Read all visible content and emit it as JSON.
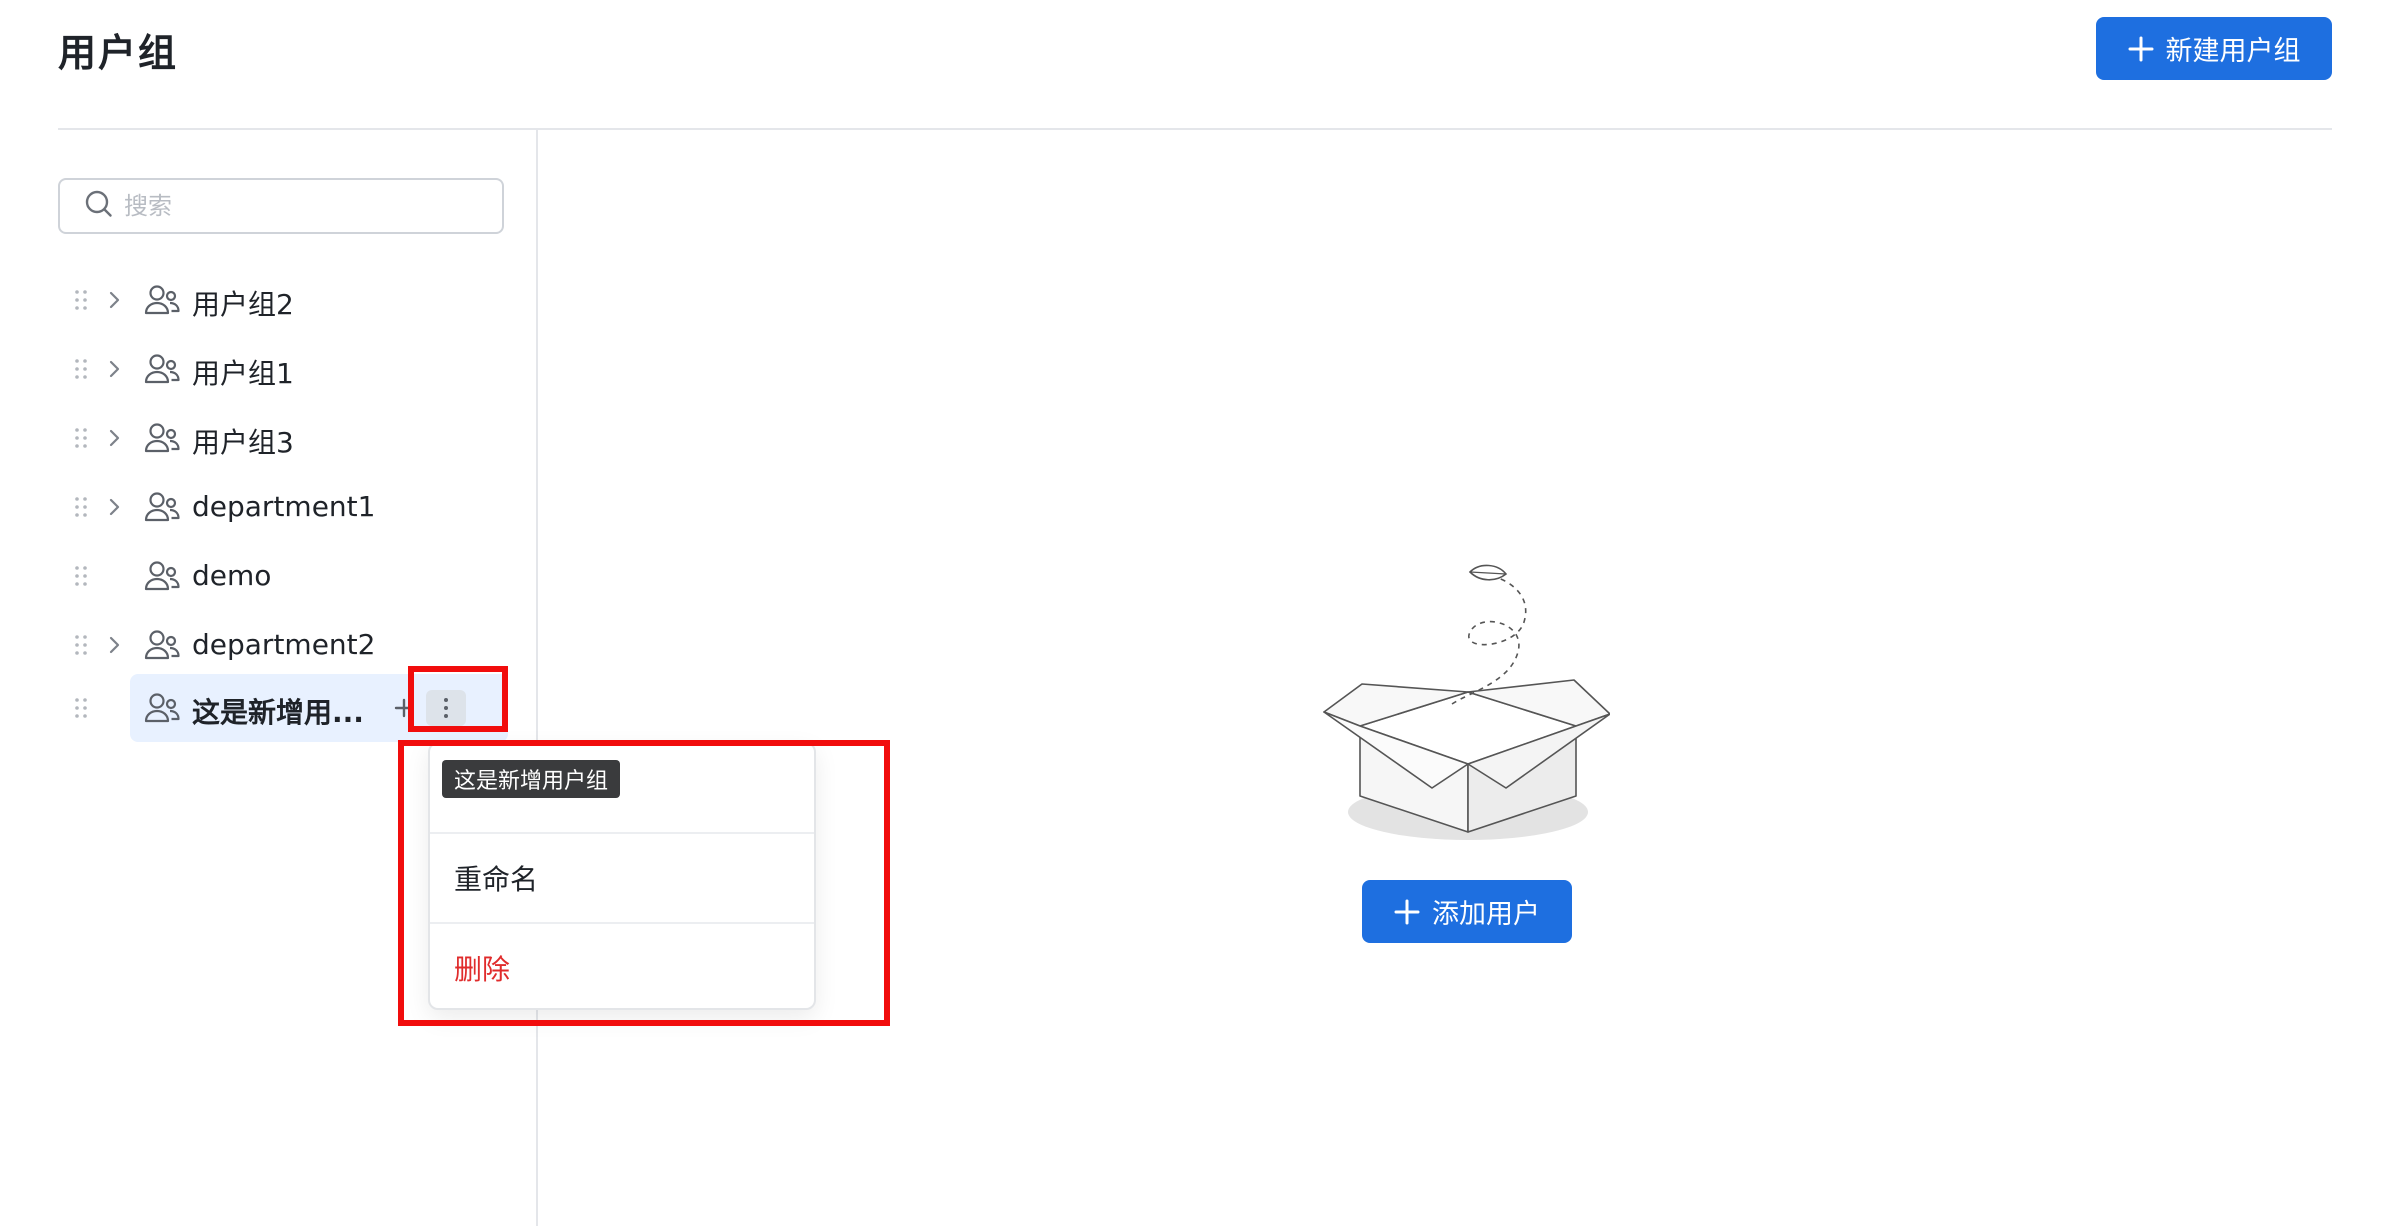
{
  "page": {
    "title": "用户组"
  },
  "header": {
    "new_group_label": "新建用户组"
  },
  "search": {
    "placeholder": "搜索"
  },
  "tree": {
    "nodes": [
      {
        "label": "用户组2",
        "expandable": true
      },
      {
        "label": "用户组1",
        "expandable": true
      },
      {
        "label": "用户组3",
        "expandable": true
      },
      {
        "label": "department1",
        "expandable": true
      },
      {
        "label": "demo",
        "expandable": false
      },
      {
        "label": "department2",
        "expandable": true
      },
      {
        "label": "这是新增用...",
        "expandable": false,
        "selected": true
      }
    ]
  },
  "menu": {
    "tooltip": "这是新增用户组",
    "items": [
      {
        "label": ""
      },
      {
        "label": "重命名"
      },
      {
        "label": "删除",
        "danger": true
      }
    ]
  },
  "main": {
    "add_user_label": "添加用户"
  },
  "icons": {
    "search": "search-icon",
    "plus": "plus-icon",
    "drag": "drag-handle-icon",
    "chevron": "chevron-right-icon",
    "group": "user-group-icon",
    "more": "more-vertical-icon",
    "empty": "empty-box-illustration"
  },
  "colors": {
    "primary": "#1e6fe0",
    "danger": "#e02c2c",
    "highlight": "#f10d0d",
    "selected_bg": "#e8f1ff"
  }
}
